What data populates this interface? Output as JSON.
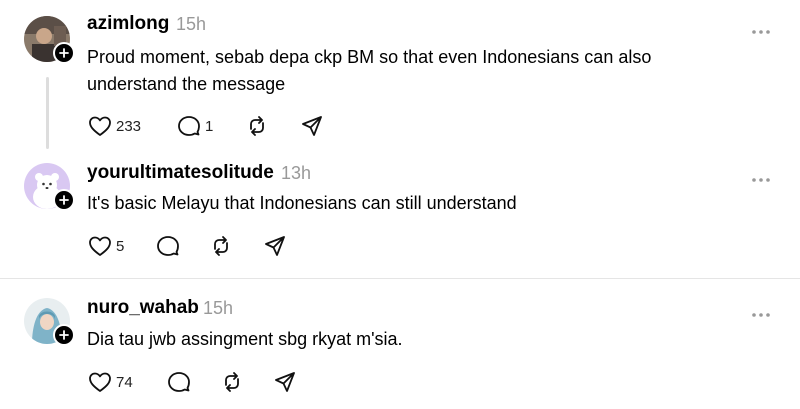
{
  "colors": {
    "text": "#000000",
    "muted": "#999999",
    "divider": "#e5e5e5",
    "thread_line": "#dddddd"
  },
  "posts": [
    {
      "username": "azimlong",
      "time": "15h",
      "line1": "Proud moment, sebab depa ckp BM so that even Indonesians can also",
      "line2": "understand the message",
      "like_count": "233",
      "reply_count": "1"
    },
    {
      "username": "yourultimatesolitude",
      "time": "13h",
      "line1": "It's basic Melayu that Indonesians can still understand",
      "like_count": "5"
    },
    {
      "username": "nuro_wahab",
      "time": "15h",
      "line1": "Dia tau jwb assingment sbg rkyat m'sia.",
      "like_count": "74"
    }
  ],
  "icons": [
    "heart-icon",
    "comment-icon",
    "repost-icon",
    "share-icon",
    "more-icon",
    "follow-plus-icon"
  ]
}
